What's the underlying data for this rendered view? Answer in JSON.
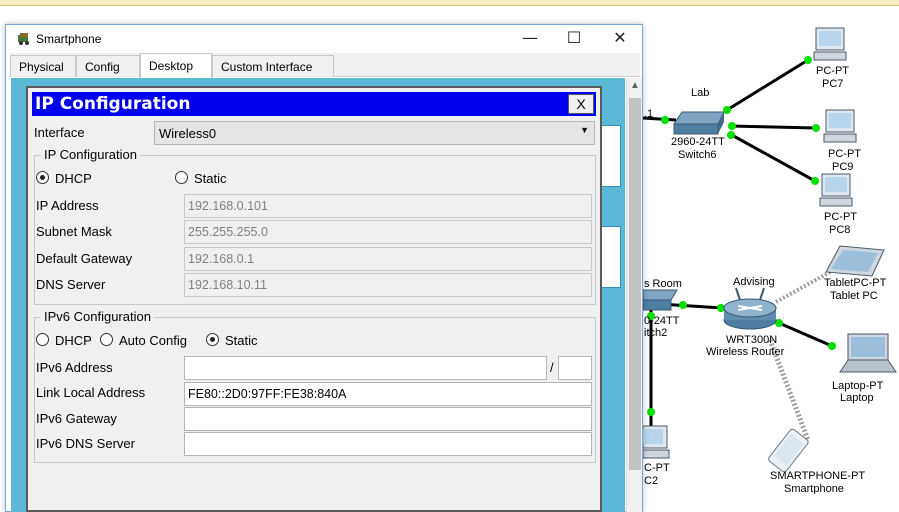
{
  "window": {
    "title": "Smartphone",
    "minimize_icon": "minimize-icon",
    "maximize_icon": "maximize-icon",
    "close_icon": "close-icon",
    "tabs": [
      {
        "label": "Physical",
        "active": false
      },
      {
        "label": "Config",
        "active": false
      },
      {
        "label": "Desktop",
        "active": true
      },
      {
        "label": "Custom Interface",
        "active": false
      }
    ]
  },
  "dialog": {
    "title": "IP Configuration",
    "close_label": "X",
    "interface_label": "Interface",
    "interface_value": "Wireless0",
    "ipv4": {
      "legend": "IP Configuration",
      "dhcp_label": "DHCP",
      "static_label": "Static",
      "selected": "DHCP",
      "ip_address_label": "IP Address",
      "ip_address": "192.168.0.101",
      "subnet_mask_label": "Subnet Mask",
      "subnet_mask": "255.255.255.0",
      "default_gateway_label": "Default Gateway",
      "default_gateway": "192.168.0.1",
      "dns_server_label": "DNS Server",
      "dns_server": "192.168.10.11"
    },
    "ipv6": {
      "legend": "IPv6 Configuration",
      "dhcp_label": "DHCP",
      "auto_config_label": "Auto Config",
      "static_label": "Static",
      "selected": "Static",
      "address_label": "IPv6 Address",
      "address": "",
      "prefix_separator": "/",
      "prefix": "",
      "link_local_label": "Link Local Address",
      "link_local": "FE80::2D0:97FF:FE38:840A",
      "gateway_label": "IPv6 Gateway",
      "gateway": "",
      "dns_label": "IPv6 DNS Server",
      "dns": ""
    }
  },
  "topology": {
    "colors": {
      "link": "#000000",
      "port": "#00e000",
      "wireless": "#a0a0a0",
      "accent_bar": "#d7c56c"
    },
    "devices": [
      {
        "id": "pc7",
        "type": "PC-PT",
        "name": "PC7",
        "icon": "pc-icon"
      },
      {
        "id": "pc9",
        "type": "PC-PT",
        "name": "PC9",
        "icon": "pc-icon"
      },
      {
        "id": "pc8",
        "type": "PC-PT",
        "name": "PC8",
        "icon": "pc-icon"
      },
      {
        "id": "switch6",
        "type": "2960-24TT",
        "name": "Switch6",
        "area": "Lab",
        "icon": "switch-icon"
      },
      {
        "id": "tablet",
        "type": "TabletPC-PT",
        "name": "Tablet PC",
        "icon": "tablet-icon"
      },
      {
        "id": "router",
        "type": "WRT300N",
        "name": "Wireless Router",
        "area": "Advising",
        "icon": "wireless-router-icon"
      },
      {
        "id": "laptop",
        "type": "Laptop-PT",
        "name": "Laptop",
        "icon": "laptop-icon"
      },
      {
        "id": "smartphone",
        "type": "SMARTPHONE-PT",
        "name": "Smartphone",
        "icon": "smartphone-icon"
      },
      {
        "id": "pc2",
        "type": "C-PT",
        "name": "C2",
        "icon": "pc-icon"
      },
      {
        "id": "switch2",
        "type": "0-24TT",
        "name": "itch2",
        "area": "s Room",
        "icon": "switch-icon"
      }
    ],
    "fragments": {
      "link_label": ".1",
      "side_letter": "r"
    }
  }
}
